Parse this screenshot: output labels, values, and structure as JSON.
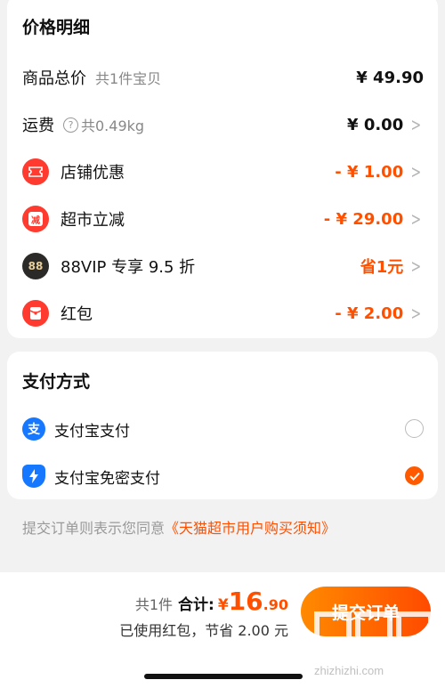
{
  "price_details": {
    "title": "价格明细",
    "total": {
      "label": "商品总价",
      "sub": "共1件宝贝",
      "value": "¥ 49.90"
    },
    "shipping": {
      "label": "运费",
      "help": "?",
      "sub": "共0.49kg",
      "value": "¥ 0.00"
    },
    "store_discount": {
      "label": "店铺优惠",
      "value": "- ¥ 1.00",
      "icon": "ticket-icon"
    },
    "market_discount": {
      "label": "超市立减",
      "value": "- ¥ 29.00",
      "icon_text": "减"
    },
    "vip": {
      "label": "88VIP 专享 9.5 折",
      "value": "省1元",
      "icon_text": "88"
    },
    "red_packet": {
      "label": "红包",
      "value": "- ¥ 2.00",
      "icon": "red-packet-icon"
    }
  },
  "payment": {
    "title": "支付方式",
    "options": [
      {
        "label": "支付宝支付",
        "icon_text": "支",
        "selected": false
      },
      {
        "label": "支付宝免密支付",
        "icon": "shield-bolt-icon",
        "selected": true
      }
    ]
  },
  "agreement": {
    "prefix": "提交订单则表示您同意",
    "link": "《天猫超市用户购买须知》"
  },
  "bottom": {
    "count": "共1件",
    "total_label": "合计:",
    "currency": "¥",
    "total_int": "16",
    "total_dec": ".90",
    "saving_note": "已使用红包，节省 2.00 元",
    "submit_label": "提交订单"
  },
  "watermark": "zhizhizhi.com",
  "colors": {
    "accent": "#ff5000",
    "red": "#ff3a2e",
    "alipay": "#1677ff"
  }
}
